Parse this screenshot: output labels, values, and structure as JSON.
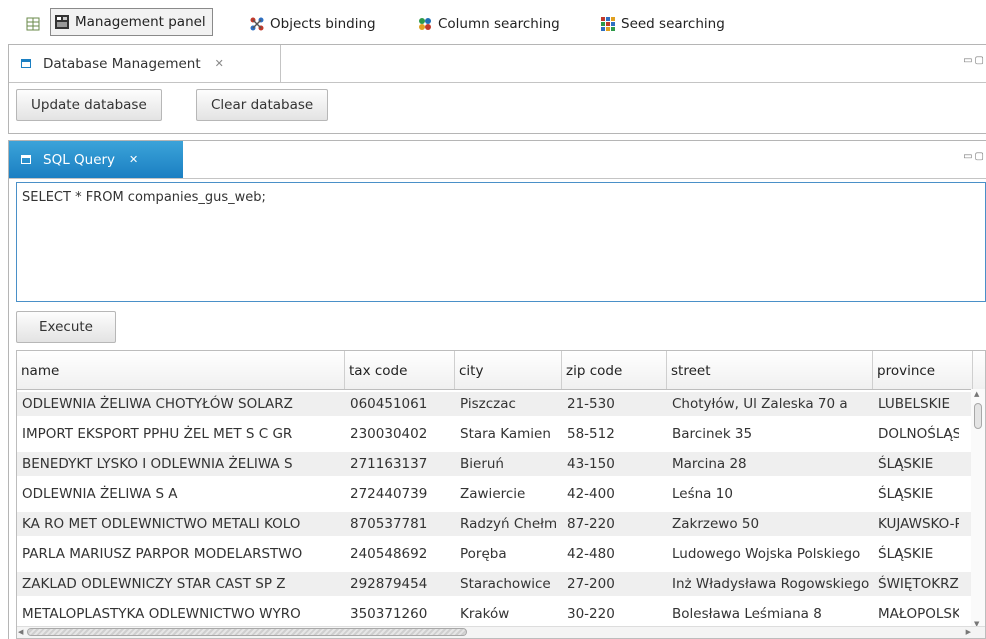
{
  "toolbar": {
    "items": [
      {
        "label": "Management panel",
        "icon": "management-panel-icon"
      },
      {
        "label": "Objects binding",
        "icon": "objects-binding-icon"
      },
      {
        "label": "Column searching",
        "icon": "column-searching-icon"
      },
      {
        "label": "Seed searching",
        "icon": "seed-searching-icon"
      }
    ]
  },
  "db_panel": {
    "tab_label": "Database Management",
    "update_label": "Update database",
    "clear_label": "Clear database"
  },
  "sql_panel": {
    "tab_label": "SQL Query",
    "query": "SELECT * FROM companies_gus_web;",
    "execute_label": "Execute"
  },
  "table": {
    "columns": [
      "name",
      "tax code",
      "city",
      "zip code",
      "street",
      "province"
    ],
    "rows": [
      [
        "ODLEWNIA ŻELIWA CHOTYŁÓW SOLARZ",
        "060451061",
        "Piszczac",
        "21-530",
        "Chotyłów, Ul Zaleska 70 a",
        "LUBELSKIE"
      ],
      [
        "IMPORT EKSPORT PPHU ŻEL MET S C GR",
        "230030402",
        "Stara Kamien",
        "58-512",
        "Barcinek 35",
        "DOLNOŚLĄSKIE"
      ],
      [
        "BENEDYKT LYSKO I ODLEWNIA ŻELIWA S",
        "271163137",
        "Bieruń",
        "43-150",
        "Marcina 28",
        "ŚLĄSKIE"
      ],
      [
        "ODLEWNIA ŻELIWA S A",
        "272440739",
        "Zawiercie",
        "42-400",
        "Leśna 10",
        "ŚLĄSKIE"
      ],
      [
        "KA RO MET ODLEWNICTWO METALI KOLO",
        "870537781",
        "Radzyń Chełm",
        "87-220",
        "Zakrzewo 50",
        "KUJAWSKO-POMORSKIE"
      ],
      [
        "PARLA MARIUSZ PARPOR MODELARSTWO",
        "240548692",
        "Poręba",
        "42-480",
        "Ludowego Wojska Polskiego",
        "ŚLĄSKIE"
      ],
      [
        "ZAKLAD ODLEWNICZY STAR CAST SP Z",
        "292879454",
        "Starachowice",
        "27-200",
        "Inż Władysława Rogowskiego",
        "ŚWIĘTOKRZYSKIE"
      ],
      [
        "METALOPLASTYKA ODLEWNICTWO WYRO",
        "350371260",
        "Kraków",
        "30-220",
        "Bolesława Leśmiana 8",
        "MAŁOPOLSKIE"
      ]
    ]
  }
}
